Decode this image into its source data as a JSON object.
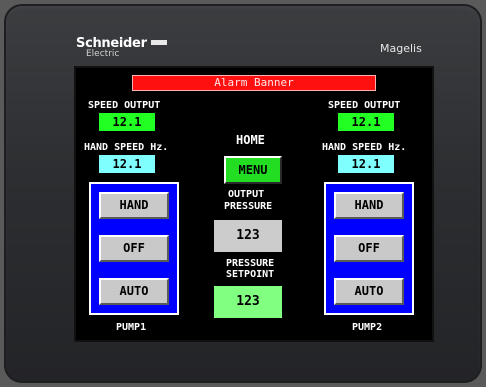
{
  "device": {
    "brand": "Schneider",
    "brand_sub": "Electric",
    "model": "Magelis"
  },
  "hmi": {
    "alarm_banner": "Alarm Banner",
    "home_label": "HOME",
    "menu_button": "MENU",
    "output_pressure_label_1": "OUTPUT",
    "output_pressure_label_2": "PRESSURE",
    "output_pressure_value": "123",
    "pressure_setpoint_label_1": "PRESSURE",
    "pressure_setpoint_label_2": "SETPOINT",
    "pressure_setpoint_value": "123",
    "left": {
      "speed_output_label": "SPEED OUTPUT",
      "speed_output_value": "12.1",
      "hand_speed_label": "HAND SPEED Hz.",
      "hand_speed_value": "12.1",
      "buttons": [
        "HAND",
        "OFF",
        "AUTO"
      ],
      "pump_label": "PUMP1"
    },
    "right": {
      "speed_output_label": "SPEED OUTPUT",
      "speed_output_value": "12.1",
      "hand_speed_label": "HAND SPEED Hz.",
      "hand_speed_value": "12.1",
      "buttons": [
        "HAND",
        "OFF",
        "AUTO"
      ],
      "pump_label": "PUMP2"
    }
  },
  "colors": {
    "alarm": "#ff1010",
    "value_green": "#22ff22",
    "value_cyan": "#80ffff",
    "panel_blue": "#0000ff",
    "button_gray": "#c9c9c9",
    "menu_green": "#22dd22",
    "setpoint_green": "#80ff80"
  }
}
